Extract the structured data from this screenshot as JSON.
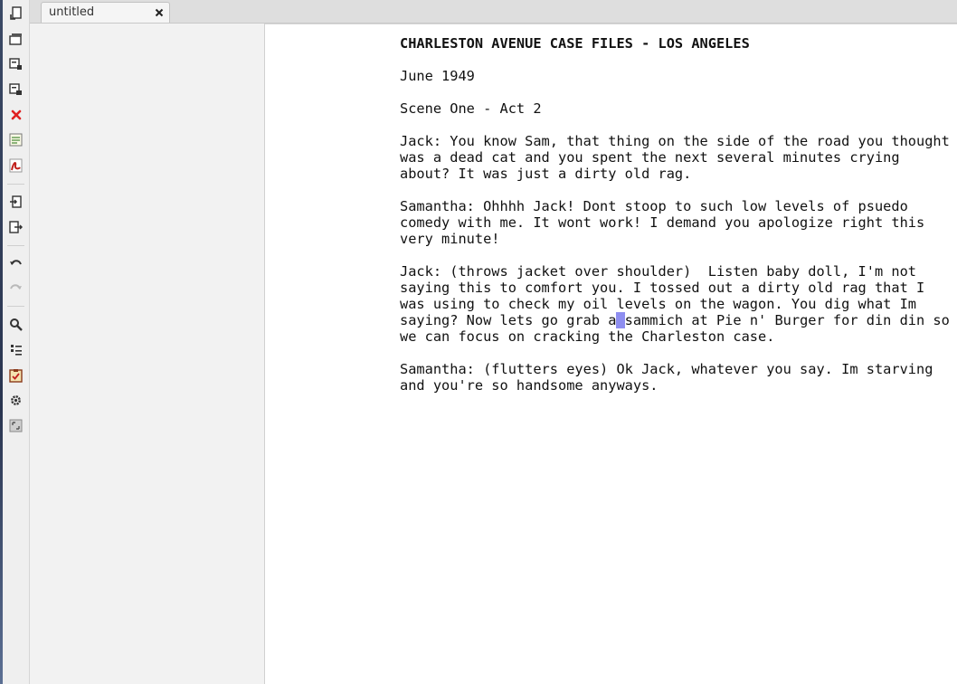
{
  "tab": {
    "title": "untitled"
  },
  "toolbar": {
    "buttons": [
      {
        "icon": "new-document-icon"
      },
      {
        "icon": "open-documents-icon"
      },
      {
        "icon": "save-icon"
      },
      {
        "icon": "save-as-icon"
      },
      {
        "icon": "close-icon"
      },
      {
        "icon": "notes-icon"
      },
      {
        "icon": "pdf-icon"
      },
      {
        "icon": "import-icon"
      },
      {
        "icon": "export-icon"
      },
      {
        "icon": "undo-icon"
      },
      {
        "icon": "redo-icon"
      },
      {
        "icon": "search-icon"
      },
      {
        "icon": "outline-list-icon"
      },
      {
        "icon": "checklist-icon"
      },
      {
        "icon": "settings-gear-icon"
      },
      {
        "icon": "fullscreen-icon"
      }
    ]
  },
  "document": {
    "title": "CHARLESTON AVENUE CASE FILES - LOS ANGELES",
    "date": "June 1949",
    "scene": "Scene One - Act 2",
    "para1": "Jack: You know Sam, that thing on the side of the road you thought was a dead cat and you spent the next several minutes crying about? It was just a dirty old rag.",
    "para2": "Samantha: Ohhhh Jack! Dont stoop to such low levels of psuedo comedy with me. It wont work! I demand you apologize right this very minute!",
    "para3_before_cursor": "Jack: (throws jacket over shoulder)  Listen baby doll, I'm not saying this to comfort you. I tossed out a dirty old rag that I was using to check my oil levels on the wagon. You dig what Im saying? Now lets go grab a",
    "para3_cursor": " ",
    "para3_after_cursor": "sammich at Pie n' Burger for din din so we can focus on cracking the Charleston case.",
    "para4": "Samantha: (flutters eyes) Ok Jack, whatever you say. Im starving and you're so handsome anyways."
  },
  "colors": {
    "selection": "#8e8ef0",
    "close_red": "#e02020"
  }
}
